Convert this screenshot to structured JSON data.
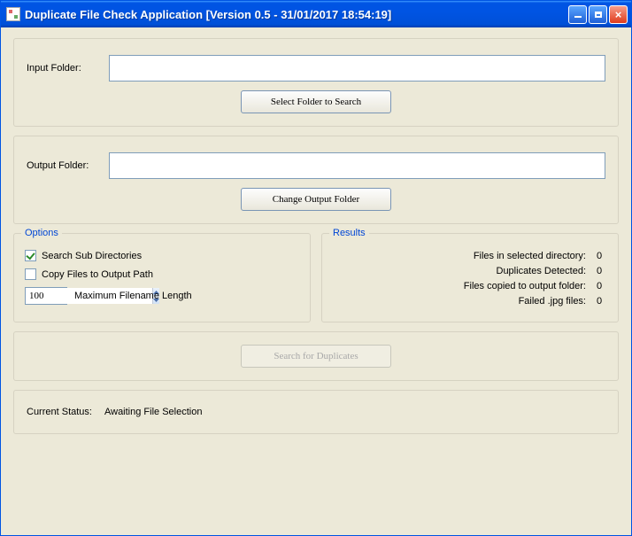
{
  "window": {
    "title": "Duplicate File Check Application [Version 0.5 - 31/01/2017 18:54:19]"
  },
  "inputFolder": {
    "label": "Input Folder:",
    "value": "",
    "button": "Select Folder to Search"
  },
  "outputFolder": {
    "label": "Output Folder:",
    "value": "",
    "button": "Change Output Folder"
  },
  "options": {
    "legend": "Options",
    "searchSub": {
      "label": "Search Sub Directories",
      "checked": true
    },
    "copyFiles": {
      "label": "Copy Files to Output Path",
      "checked": false
    },
    "maxFilename": {
      "label": "Maximum Filename Length",
      "value": "100"
    }
  },
  "results": {
    "legend": "Results",
    "rows": [
      {
        "label": "Files in selected directory:",
        "value": "0"
      },
      {
        "label": "Duplicates Detected:",
        "value": "0"
      },
      {
        "label": "Files copied to output folder:",
        "value": "0"
      },
      {
        "label": "Failed .jpg files:",
        "value": "0"
      }
    ]
  },
  "searchButton": "Search for Duplicates",
  "status": {
    "label": "Current Status:",
    "value": "Awaiting File Selection"
  }
}
